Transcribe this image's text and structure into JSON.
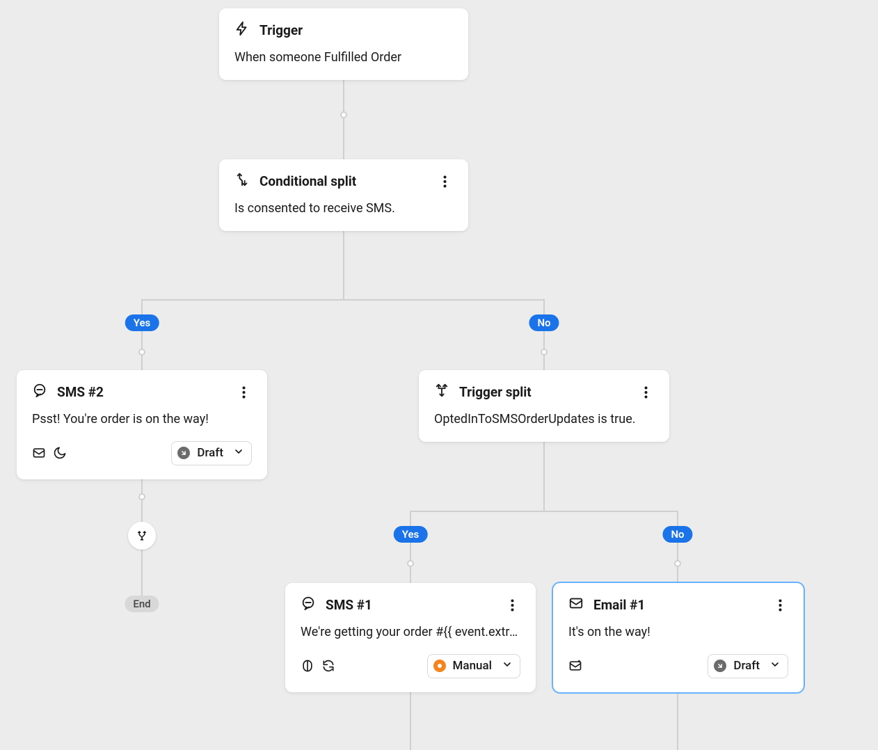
{
  "trigger": {
    "title": "Trigger",
    "desc": "When someone Fulfilled Order"
  },
  "cond": {
    "title": "Conditional split",
    "desc": "Is consented to receive SMS."
  },
  "branches1": {
    "yes": "Yes",
    "no": "No"
  },
  "sms2": {
    "title": "SMS #2",
    "desc": "Psst! You're order is on the way!",
    "status": "Draft"
  },
  "trigsplit": {
    "title": "Trigger split",
    "desc": "OptedInToSMSOrderUpdates is true."
  },
  "branches2": {
    "yes": "Yes",
    "no": "No"
  },
  "sms1": {
    "title": "SMS #1",
    "desc": "We're getting your order #{{ event.extra.o…",
    "status": "Manual"
  },
  "email1": {
    "title": "Email #1",
    "desc": "It's on the way!",
    "status": "Draft"
  },
  "end": "End"
}
